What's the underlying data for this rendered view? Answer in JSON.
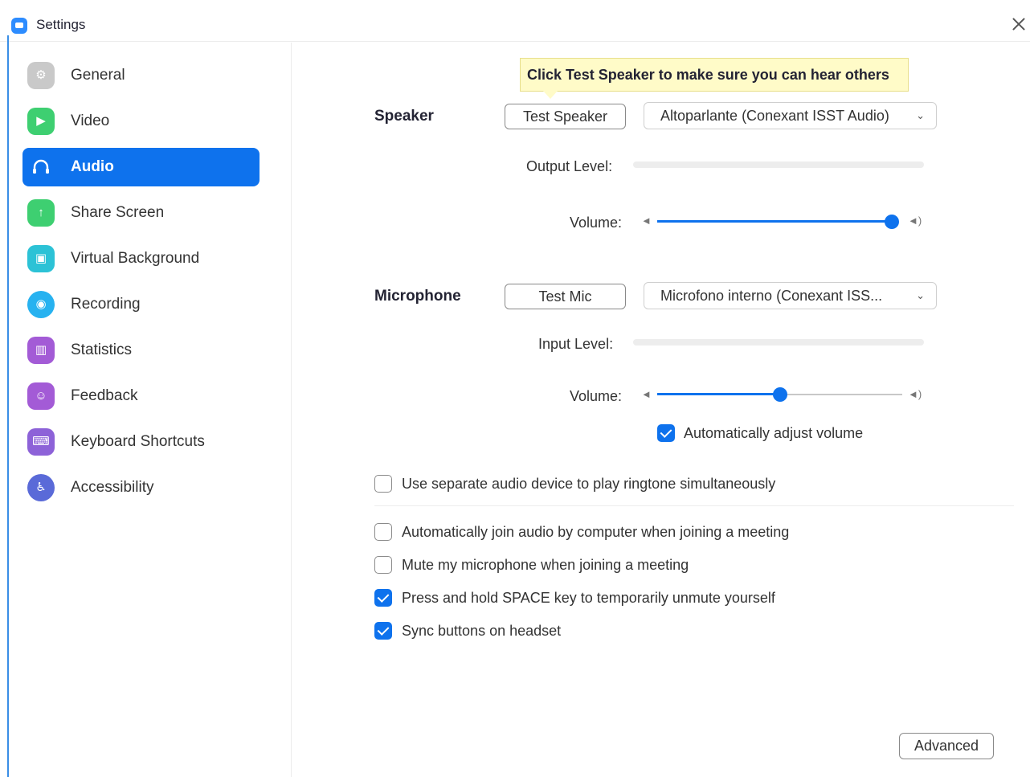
{
  "window": {
    "title": "Settings"
  },
  "sidebar": {
    "items": [
      {
        "label": "General",
        "icon": "gear-icon",
        "color": "#c9c9c9",
        "glyph": "⚙"
      },
      {
        "label": "Video",
        "icon": "video-camera-icon",
        "color": "#3ecf71",
        "glyph": "▶"
      },
      {
        "label": "Audio",
        "icon": "headphones-icon",
        "color": "#0e72ed",
        "glyph": "∩",
        "active": true
      },
      {
        "label": "Share Screen",
        "icon": "share-screen-icon",
        "color": "#3ecf71",
        "glyph": "↑"
      },
      {
        "label": "Virtual Background",
        "icon": "virtual-background-icon",
        "color": "#2cc2d6",
        "glyph": "▣"
      },
      {
        "label": "Recording",
        "icon": "recording-icon",
        "color": "#27b2f0",
        "glyph": "◉"
      },
      {
        "label": "Statistics",
        "icon": "statistics-icon",
        "color": "#a35bd6",
        "glyph": "▥"
      },
      {
        "label": "Feedback",
        "icon": "feedback-icon",
        "color": "#a35bd6",
        "glyph": "☺"
      },
      {
        "label": "Keyboard Shortcuts",
        "icon": "keyboard-icon",
        "color": "#8d62d8",
        "glyph": "⌨"
      },
      {
        "label": "Accessibility",
        "icon": "accessibility-icon",
        "color": "#5a6ad8",
        "glyph": "♿"
      }
    ]
  },
  "speaker": {
    "label": "Speaker",
    "tooltip": "Click Test Speaker to make sure you can hear others",
    "test_button": "Test Speaker",
    "device": "Altoparlante (Conexant ISST Audio)",
    "output_level_label": "Output Level:",
    "volume_label": "Volume:",
    "volume": 1.0
  },
  "microphone": {
    "label": "Microphone",
    "test_button": "Test Mic",
    "device": "Microfono interno (Conexant ISS...",
    "input_level_label": "Input Level:",
    "volume_label": "Volume:",
    "volume": 0.5,
    "auto_adjust": {
      "label": "Automatically adjust volume",
      "checked": true
    }
  },
  "options": {
    "ringtone": {
      "label": "Use separate audio device to play ringtone simultaneously",
      "checked": false
    },
    "auto_join": {
      "label": "Automatically join audio by computer when joining a meeting",
      "checked": false
    },
    "mute_on_join": {
      "label": "Mute my microphone when joining a meeting",
      "checked": false
    },
    "space_unmute": {
      "label": "Press and hold SPACE key to temporarily unmute yourself",
      "checked": true
    },
    "sync_headset": {
      "label": "Sync buttons on headset",
      "checked": true
    }
  },
  "advanced_button": "Advanced",
  "colors": {
    "accent": "#0e72ed",
    "tooltip_bg": "#fffbc8"
  }
}
